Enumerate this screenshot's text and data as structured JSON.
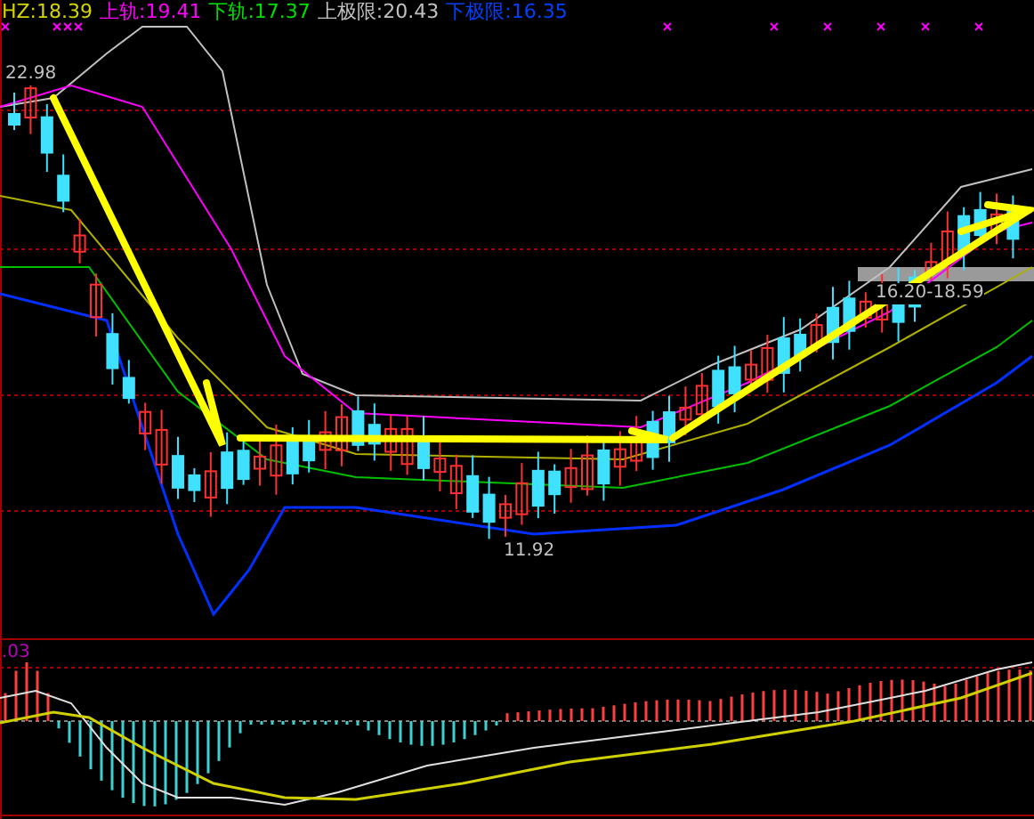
{
  "legend": [
    {
      "text": "HZ:18.39",
      "color": "#d4d400"
    },
    {
      "text": "上轨:19.41",
      "color": "#ff00ff"
    },
    {
      "text": "下轨:17.37",
      "color": "#00e000"
    },
    {
      "text": "上极限:20.43",
      "color": "#c0c0c0"
    },
    {
      "text": "下极限:16.35",
      "color": "#0040ff"
    }
  ],
  "price_labels": [
    {
      "kind": "high",
      "text": "22.98"
    },
    {
      "kind": "low",
      "text": "11.92"
    },
    {
      "kind": "band",
      "text": "16.20-18.59"
    }
  ],
  "macd_label": ".03"
}
